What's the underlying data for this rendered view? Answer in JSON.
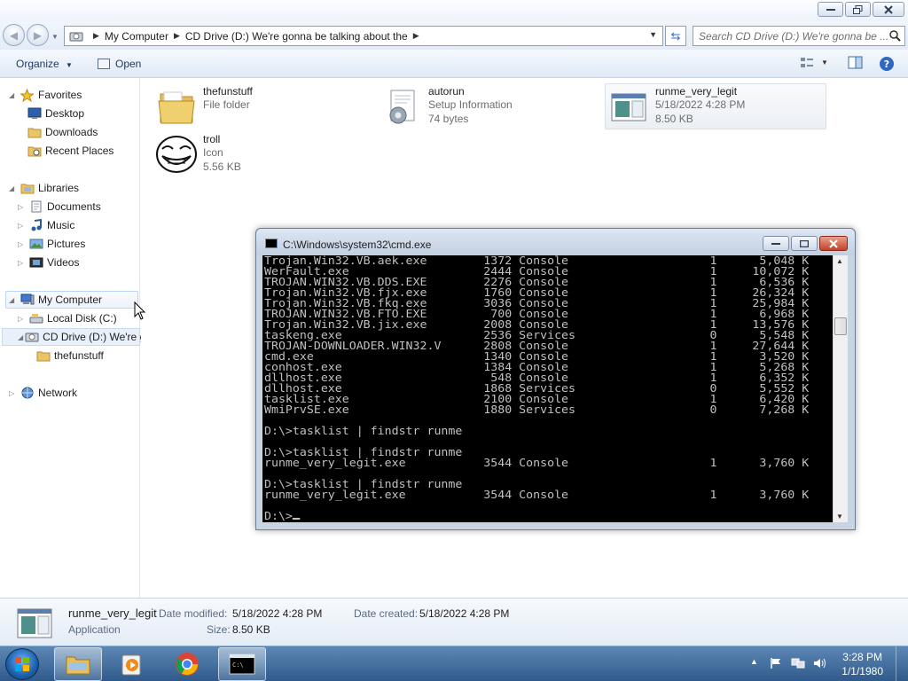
{
  "explorer": {
    "address": {
      "crumbs": [
        "My Computer",
        "CD Drive (D:) We're gonna be talking about the"
      ]
    },
    "search": {
      "placeholder": "Search CD Drive (D:) We're gonna be ..."
    },
    "toolbar": {
      "organize": "Organize",
      "open": "Open"
    },
    "nav": {
      "favorites": "Favorites",
      "desktop": "Desktop",
      "downloads": "Downloads",
      "recent_places": "Recent Places",
      "libraries": "Libraries",
      "documents": "Documents",
      "music": "Music",
      "pictures": "Pictures",
      "videos": "Videos",
      "my_computer": "My Computer",
      "local_disk": "Local Disk (C:)",
      "cd_drive": "CD Drive (D:) We're g",
      "thefunstuff": "thefunstuff",
      "network": "Network"
    },
    "files": [
      {
        "name": "thefunstuff",
        "line1": "File folder",
        "line2": ""
      },
      {
        "name": "autorun",
        "line1": "Setup Information",
        "line2": "74 bytes"
      },
      {
        "name": "runme_very_legit",
        "line1": "5/18/2022 4:28 PM",
        "line2": "8.50 KB"
      },
      {
        "name": "troll",
        "line1": "Icon",
        "line2": "5.56 KB"
      }
    ],
    "details": {
      "name": "runme_very_legit",
      "type": "Application",
      "date_modified_label": "Date modified:",
      "date_modified": "5/18/2022 4:28 PM",
      "date_created_label": "Date created:",
      "date_created": "5/18/2022 4:28 PM",
      "size_label": "Size:",
      "size": "8.50 KB"
    }
  },
  "cmd": {
    "title": "C:\\Windows\\system32\\cmd.exe",
    "lines": [
      "Trojan.Win32.VB.aek.exe        1372 Console                    1      5,048 K",
      "WerFault.exe                   2444 Console                    1     10,072 K",
      "TROJAN.WIN32.VB.DDS.EXE        2276 Console                    1      6,536 K",
      "Trojan.Win32.VB.fjx.exe        1760 Console                    1     26,324 K",
      "Trojan.Win32.VB.fkq.exe        3036 Console                    1     25,984 K",
      "TROJAN.WIN32.VB.FTO.EXE         700 Console                    1      6,968 K",
      "Trojan.Win32.VB.jix.exe        2008 Console                    1     13,576 K",
      "taskeng.exe                    2536 Services                   0      5,548 K",
      "TROJAN-DOWNLOADER.WIN32.V      2808 Console                    1     27,644 K",
      "cmd.exe                        1340 Console                    1      3,520 K",
      "conhost.exe                    1384 Console                    1      5,268 K",
      "dllhost.exe                     548 Console                    1      6,352 K",
      "dllhost.exe                    1868 Services                   0      5,552 K",
      "tasklist.exe                   2100 Console                    1      6,420 K",
      "WmiPrvSE.exe                   1880 Services                   0      7,268 K",
      "",
      "D:\\>tasklist | findstr runme",
      "",
      "D:\\>tasklist | findstr runme",
      "runme_very_legit.exe           3544 Console                    1      3,760 K",
      "",
      "D:\\>tasklist | findstr runme",
      "runme_very_legit.exe           3544 Console                    1      3,760 K",
      "",
      "D:\\>"
    ]
  },
  "taskbar": {
    "time": "3:28 PM",
    "date": "1/1/1980"
  }
}
